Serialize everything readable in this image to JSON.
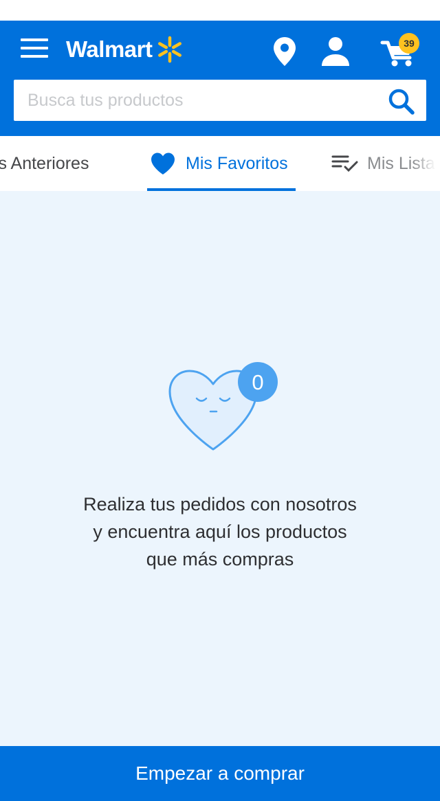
{
  "header": {
    "logo_text": "Walmart",
    "brand_color": "#0071dc",
    "spark_color": "#ffc220",
    "cart_count": "39"
  },
  "search": {
    "placeholder": "Busca tus productos"
  },
  "tabs": [
    {
      "label": "Pedidos Anteriores",
      "visible_label": "los Anteriores",
      "active": false
    },
    {
      "label": "Mis Favoritos",
      "active": true,
      "icon": "heart-icon"
    },
    {
      "label": "Mis Listas",
      "active": false,
      "icon": "checklist-icon"
    }
  ],
  "empty_state": {
    "badge_count": "0",
    "lines": [
      "Realiza tus pedidos con nosotros",
      "y encuentra aquí los productos",
      "que más compras"
    ]
  },
  "cta": {
    "label": "Empezar a comprar"
  }
}
